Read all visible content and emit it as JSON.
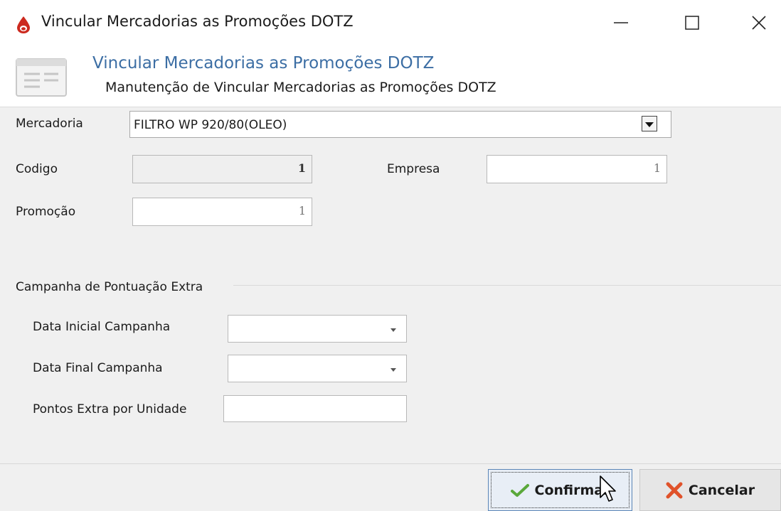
{
  "window": {
    "title": "Vincular Mercadorias as Promoções DOTZ",
    "icon": "drop-icon",
    "controls": [
      "minimize-icon",
      "maximize-icon",
      "close-icon"
    ]
  },
  "header": {
    "title": "Vincular Mercadorias as Promoções DOTZ",
    "subtitle": "Manutenção de Vincular Mercadorias as Promoções DOTZ",
    "icon": "form-icon"
  },
  "form": {
    "mercadoria": {
      "label": "Mercadoria",
      "value": "FILTRO WP 920/80(OLEO)"
    },
    "codigo": {
      "label": "Codigo",
      "value": "1"
    },
    "empresa": {
      "label": "Empresa",
      "value": "1"
    },
    "promocao": {
      "label": "Promoção",
      "value": "1"
    }
  },
  "campanha": {
    "title": "Campanha de Pontuação Extra",
    "data_inicial": {
      "label": "Data Inicial Campanha",
      "value": ""
    },
    "data_final": {
      "label": "Data Final Campanha",
      "value": ""
    },
    "pontos_extra": {
      "label": "Pontos Extra por Unidade",
      "value": ""
    }
  },
  "buttons": {
    "confirmar": "Confirmar",
    "cancelar": "Cancelar"
  },
  "colors": {
    "header_title": "#3c6ea4",
    "confirm_check": "#5aa83a",
    "cancel_x": "#e0522a",
    "app_icon": "#cc2a1f"
  }
}
